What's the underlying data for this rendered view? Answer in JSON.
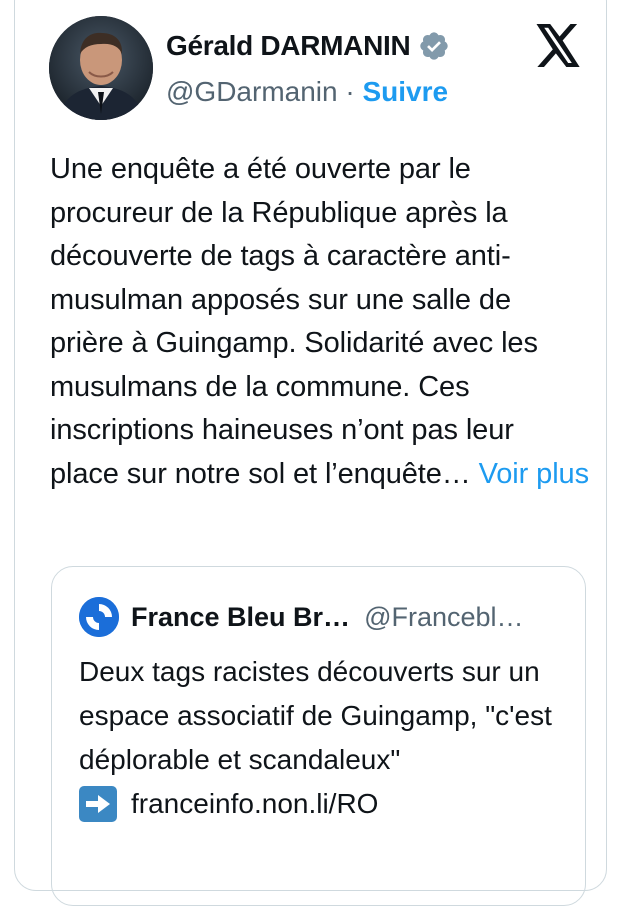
{
  "author": {
    "name": "Gérald DARMANIN",
    "handle": "@GDarmanin",
    "separator": "·",
    "follow_label": "Suivre",
    "verified_color": "#829aab"
  },
  "tweet": {
    "text": "Une enquête a été ouverte par le procureur de la République après la découverte de tags à caractère anti-musulman apposés sur une salle de prière à Guingamp. Solidarité avec les musulmans de la commune. Ces inscriptions haineuses n’ont pas leur place sur notre sol et l’enquête…",
    "more_label": "Voir plus"
  },
  "quoted": {
    "name": "France Bleu Br…",
    "handle": "@Francebl…",
    "text": "Deux tags racistes découverts sur un espace associatif de Guingamp, \"c'est déplorable et scandaleux\"",
    "link": "franceinfo.non.li/RO"
  },
  "icons": {
    "platform": "x-logo-icon",
    "verified": "verified-badge-icon",
    "arrow": "right-arrow-emoji-icon"
  },
  "colors": {
    "link": "#1d9bf0",
    "text": "#0f1419",
    "secondary": "#536471",
    "border": "#cfd9de"
  }
}
